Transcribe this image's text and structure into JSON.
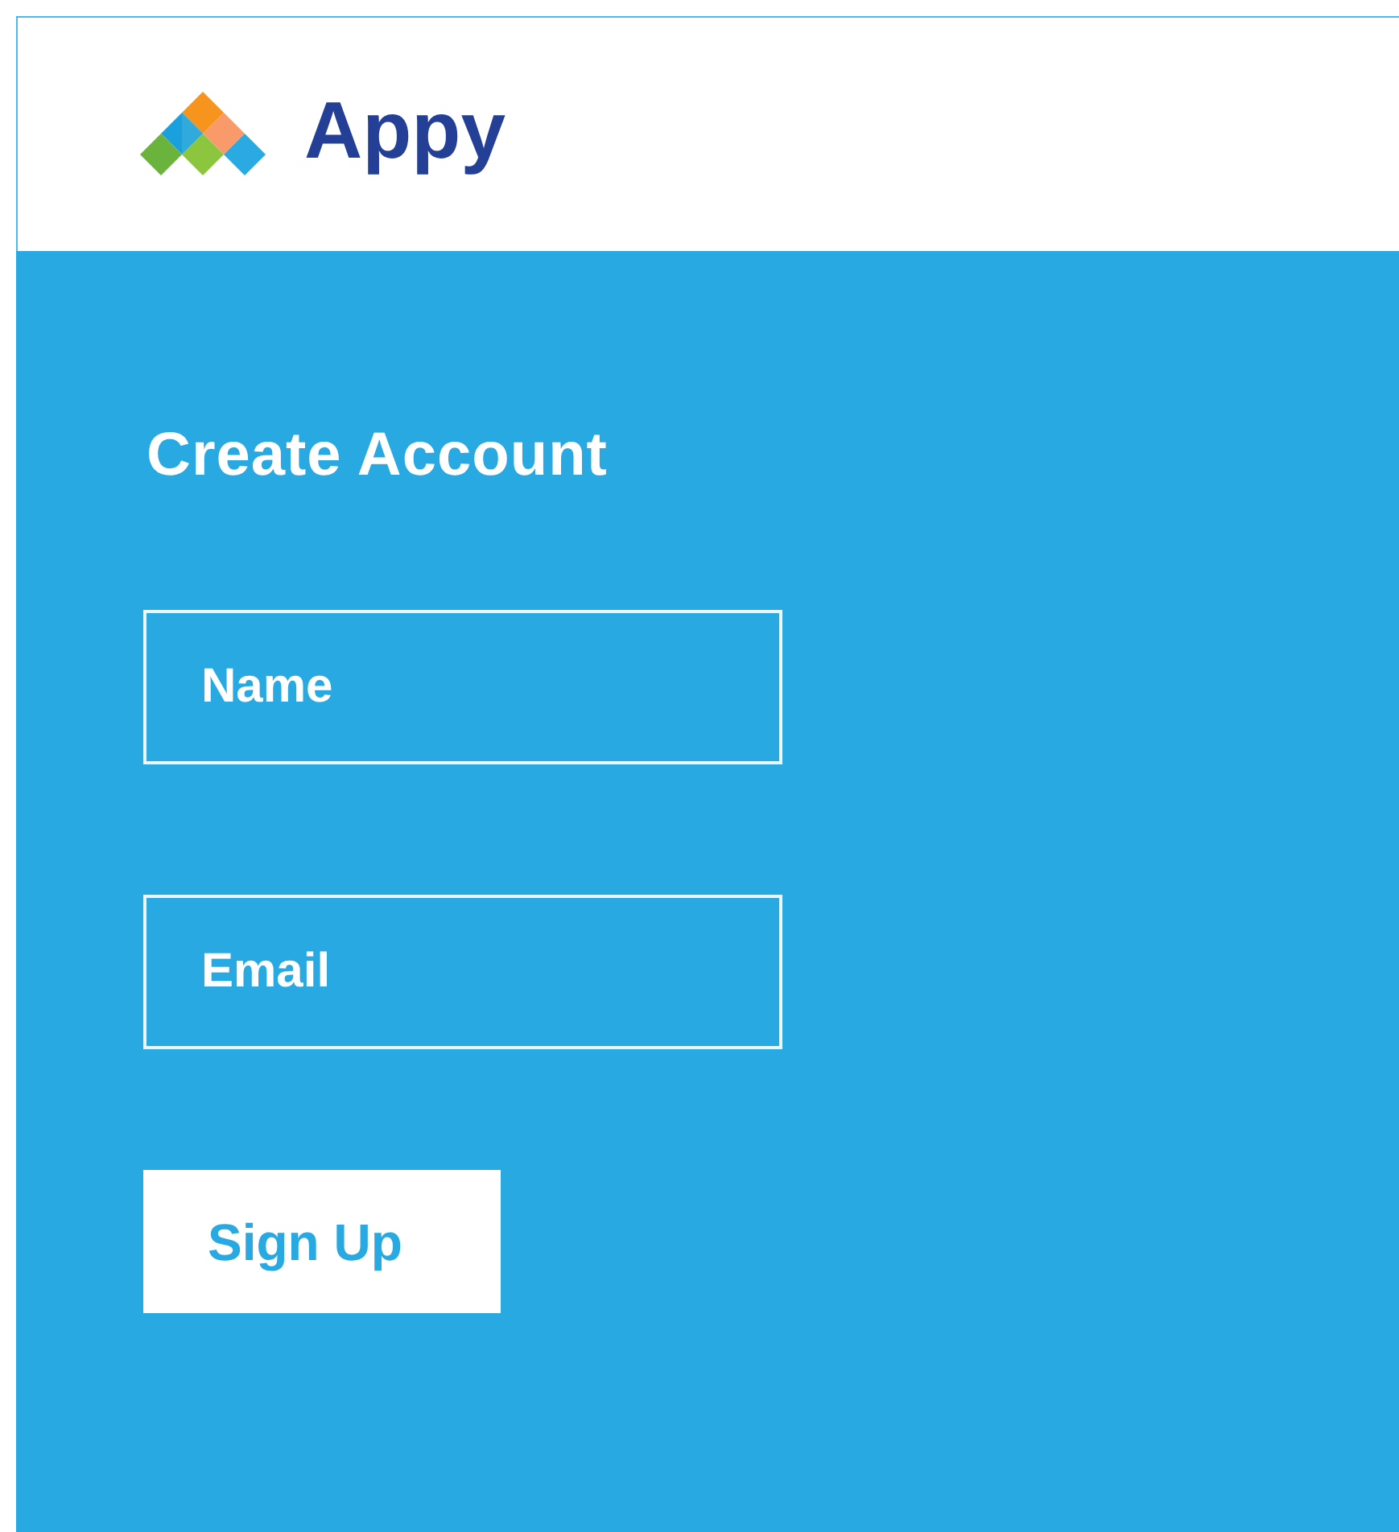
{
  "header": {
    "brand": "Appy"
  },
  "form": {
    "title": "Create Account",
    "fields": [
      {
        "placeholder": "Name"
      },
      {
        "placeholder": "Email"
      }
    ],
    "submit": "Sign Up"
  }
}
